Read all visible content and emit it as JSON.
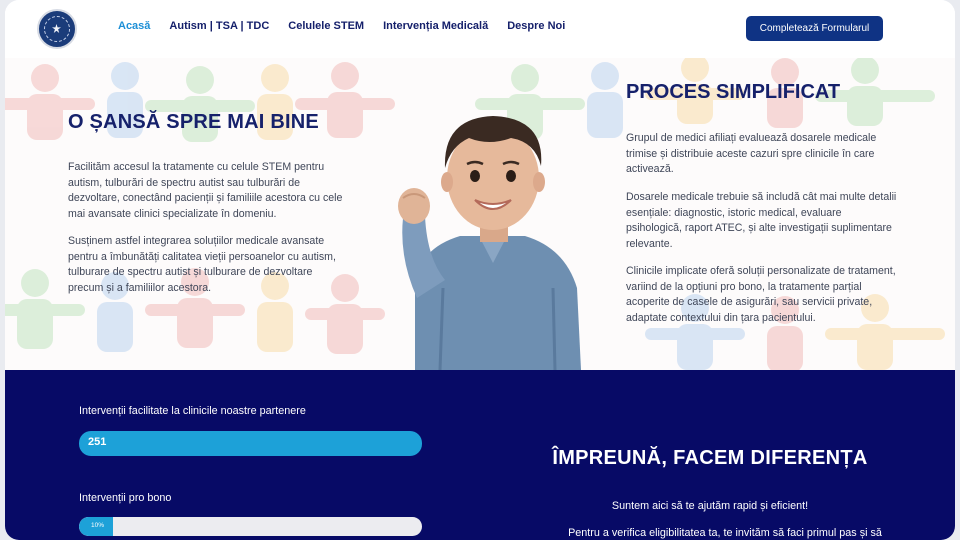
{
  "header": {
    "logo_alt": "logo",
    "nav": [
      {
        "label": "Acasă"
      },
      {
        "label": "Autism | TSA | TDC"
      },
      {
        "label": "Celulele STEM"
      },
      {
        "label": "Intervenția Medicală"
      },
      {
        "label": "Despre Noi"
      }
    ],
    "cta_label": "Completează Formularul"
  },
  "hero": {
    "title": "O ȘANSĂ SPRE MAI BINE",
    "p1": "Facilităm accesul la tratamente cu celule STEM pentru autism, tulburări de spectru autist sau tulburări de dezvoltare, conectând pacienții și familiile acestora cu cele mai avansate clinici specializate în domeniu.",
    "p2": "Susținem astfel integrarea soluțiilor medicale avansate pentru a îmbunătăți calitatea vieții persoanelor cu autism, tulburare de spectru autist și tulburare de dezvoltare precum și a familiilor acestora."
  },
  "process": {
    "title": "PROCES SIMPLIFICAT",
    "p1": "Grupul de medici afiliați evaluează dosarele medicale trimise și distribuie aceste cazuri spre clinicile în care activează.",
    "p2": "Dosarele medicale trebuie să includă cât mai multe detalii esențiale: diagnostic, istoric medical, evaluare psihologică, raport ATEC, și alte investigații suplimentare relevante.",
    "p3": "Clinicile implicate oferă soluții personalizate de tratament, variind de la opțiuni pro bono, la tratamente parțial acoperite de casele de asigurări, sau servicii private, adaptate contextului din țara pacientului."
  },
  "stats": {
    "bar1_label": "Intervenții facilitate la clinicile noastre partenere",
    "bar1_value": "251",
    "bar2_label": "Intervenții pro bono",
    "bar2_value": "10%",
    "bar2_fraction": 0.1
  },
  "together": {
    "title": "ÎMPREUNĂ, FACEM DIFERENȚA",
    "subtitle": "Suntem aici să te ajutăm rapid și eficient!",
    "text": "Pentru a verifica eligibilitatea ta, te invităm să faci primul pas și să"
  },
  "colors": {
    "navy": "#16216b",
    "accent": "#1d8fd6",
    "band": "#070a66",
    "cta": "#0f3384"
  }
}
